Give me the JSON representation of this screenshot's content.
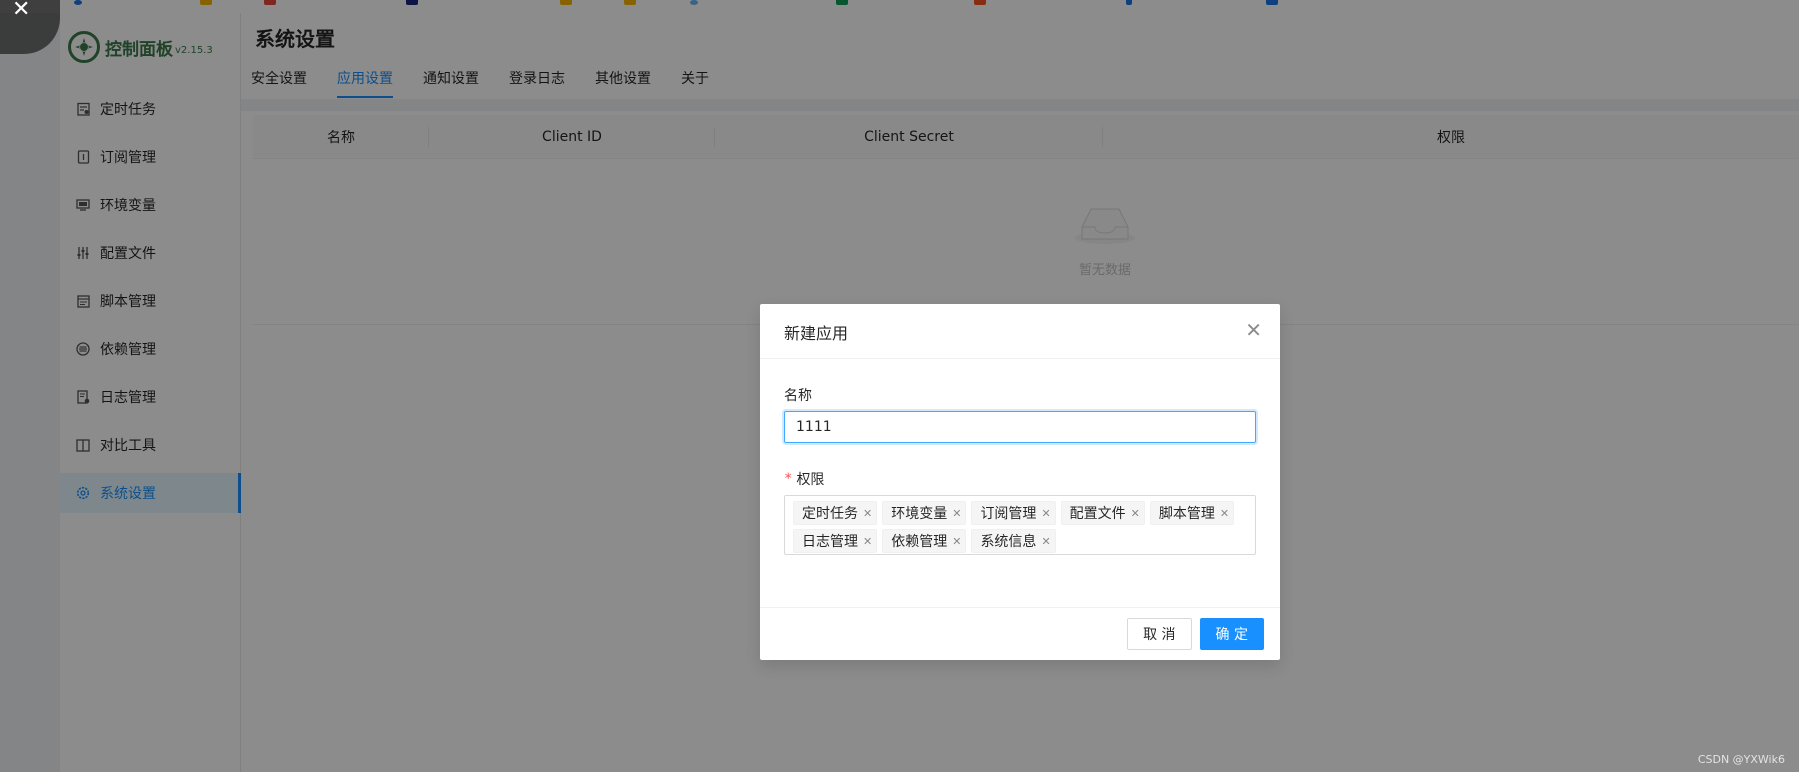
{
  "colors": {
    "accent": "#1890ff",
    "brand": "#3b7a4a",
    "required": "#ff4d4f"
  },
  "sidebar": {
    "logo": {
      "title": "控制面板",
      "version": "v2.15.3"
    },
    "items": [
      {
        "label": "定时任务",
        "icon": "calendar-icon",
        "active": false
      },
      {
        "label": "订阅管理",
        "icon": "subscription-icon",
        "active": false
      },
      {
        "label": "环境变量",
        "icon": "monitor-icon",
        "active": false
      },
      {
        "label": "配置文件",
        "icon": "sliders-icon",
        "active": false
      },
      {
        "label": "脚本管理",
        "icon": "script-icon",
        "active": false
      },
      {
        "label": "依赖管理",
        "icon": "database-icon",
        "active": false
      },
      {
        "label": "日志管理",
        "icon": "log-icon",
        "active": false
      },
      {
        "label": "对比工具",
        "icon": "diff-icon",
        "active": false
      },
      {
        "label": "系统设置",
        "icon": "gear-icon",
        "active": true
      }
    ]
  },
  "header": {
    "title": "系统设置",
    "tabs": [
      "安全设置",
      "应用设置",
      "通知设置",
      "登录日志",
      "其他设置",
      "关于"
    ],
    "active_tab": "应用设置"
  },
  "table": {
    "columns": [
      "名称",
      "Client ID",
      "Client Secret",
      "权限"
    ],
    "empty_text": "暂无数据"
  },
  "modal": {
    "title": "新建应用",
    "name_label": "名称",
    "name_value": "1111",
    "scope_label": "权限",
    "required_mark": "*",
    "tags": [
      "定时任务",
      "环境变量",
      "订阅管理",
      "配置文件",
      "脚本管理",
      "日志管理",
      "依赖管理",
      "系统信息"
    ],
    "cancel_label": "取 消",
    "ok_label": "确 定"
  },
  "watermark": "CSDN @YXWik6"
}
